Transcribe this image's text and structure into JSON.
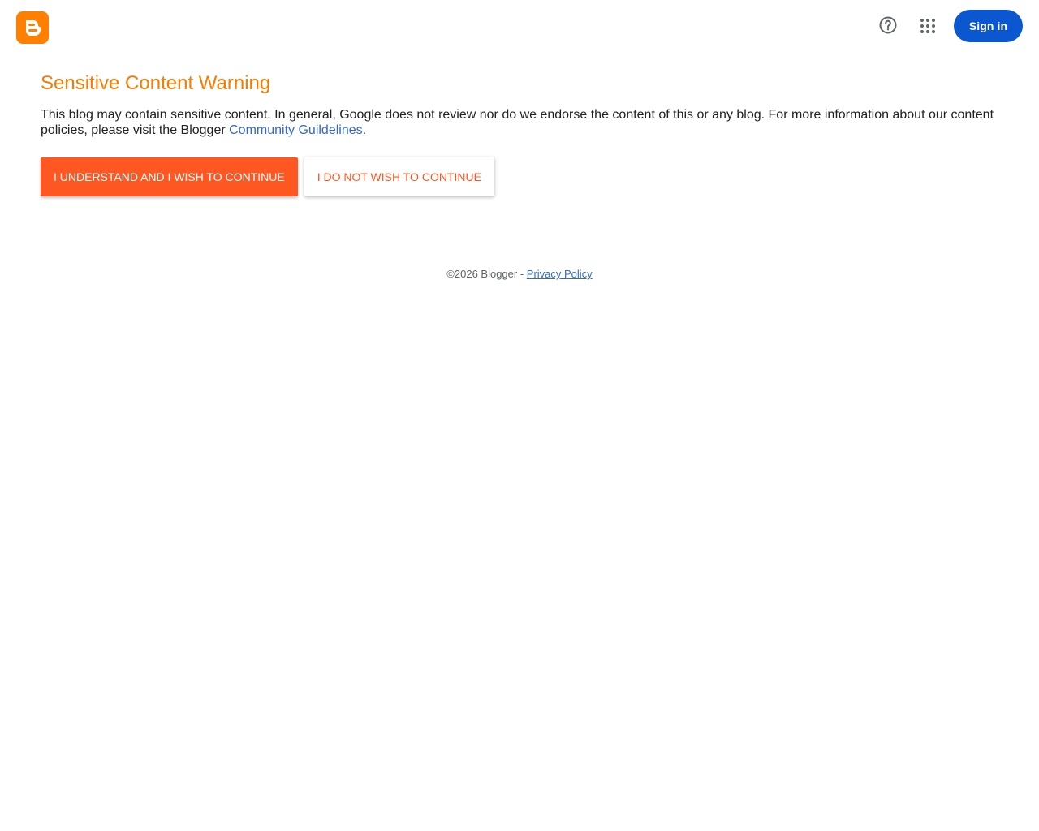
{
  "header": {
    "logo_icon": "blogger-logo",
    "help_icon": "help-circle-icon",
    "apps_icon": "apps-grid-icon",
    "signin_label": "Sign in"
  },
  "warning": {
    "title": "Sensitive Content Warning",
    "description_prefix": "This blog may contain sensitive content. In general, Google does not review nor do we endorse the content of this or any blog. For more information about our content policies, please visit the Blogger ",
    "guidelines_link": "Community Guildelines",
    "description_suffix": ".",
    "continue_label": "I UNDERSTAND AND I WISH TO CONTINUE",
    "decline_label": "I DO NOT WISH TO CONTINUE"
  },
  "footer": {
    "copyright": "©2026 Blogger - ",
    "privacy_link": "Privacy Policy"
  },
  "colors": {
    "logo_orange": "#ff8000",
    "title_orange": "#f57c00",
    "continue_bg": "#ff5722",
    "decline_text": "#ff5722",
    "signin_bg": "#0b57d0",
    "link_blue": "#3367d6"
  }
}
